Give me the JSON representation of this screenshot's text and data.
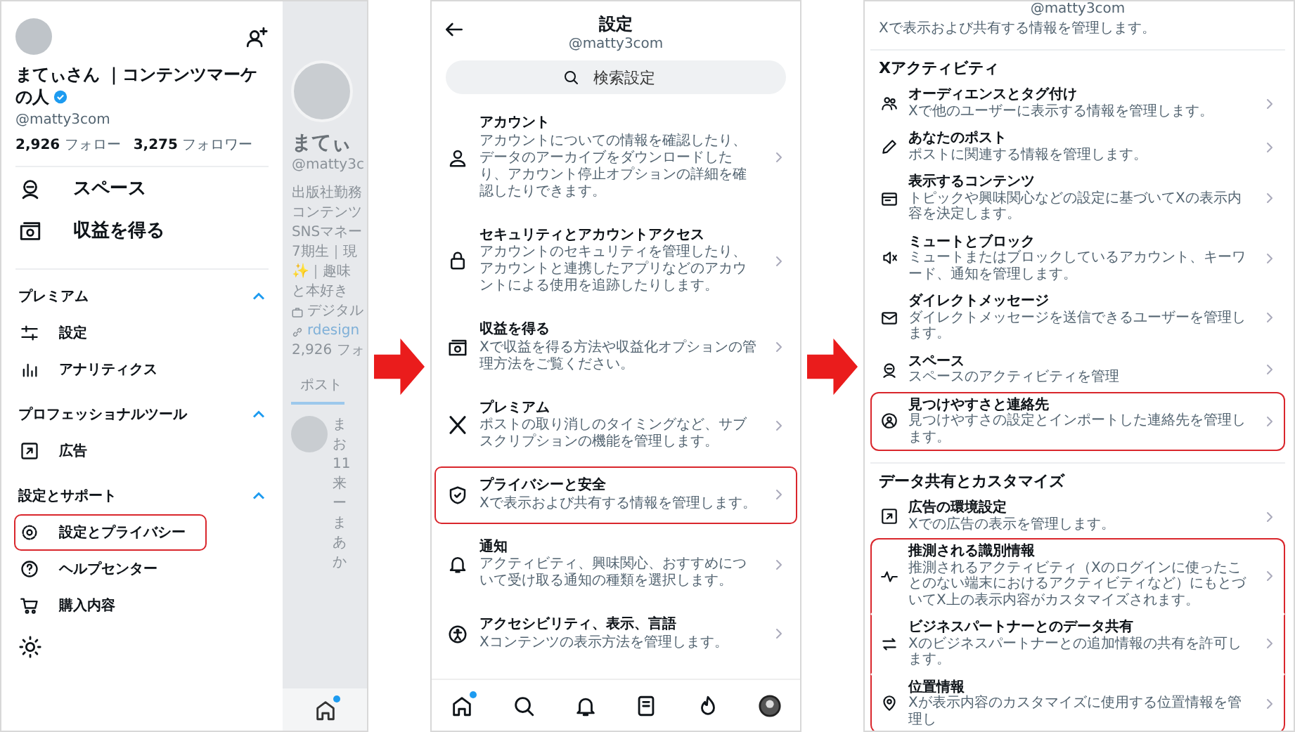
{
  "drawer": {
    "name": "まてぃさん ｜コンテンツマーケの人",
    "verified": true,
    "handle": "@matty3com",
    "stats": [
      "**2,926** フォロー",
      "**3,275** フォロワー"
    ],
    "main_items": [
      "スペース",
      "収益を得る"
    ],
    "sections": [
      {
        "title": "プレミアム",
        "expanded": true,
        "items": [
          {
            "label": "設定",
            "highlighted": false
          },
          {
            "label": "アナリティクス",
            "highlighted": false
          }
        ]
      },
      {
        "title": "プロフェッショナルツール",
        "expanded": true,
        "items": [
          {
            "label": "広告",
            "highlighted": false
          }
        ]
      },
      {
        "title": "設定とサポート",
        "expanded": true,
        "items": [
          {
            "label": "設定とプライバシー",
            "highlighted": true
          },
          {
            "label": "ヘルプセンター",
            "highlighted": false
          },
          {
            "label": "購入内容",
            "highlighted": false
          }
        ]
      }
    ]
  },
  "profile_behind": {
    "name": "まてぃ",
    "handle": "@matty3c",
    "bio": [
      "出版社勤務",
      "コンテンツ",
      "SNSマネー",
      "7期生｜現",
      "✨｜趣味",
      "と本好き"
    ],
    "work": "デジタル",
    "link": "rdesign",
    "following": "2,926 フォ",
    "tab": "ポスト",
    "post_head": [
      "ま",
      "お"
    ],
    "post_body": [
      "11",
      "来",
      "ー",
      "ま",
      "あ",
      "か"
    ],
    "home_dot": true
  },
  "settings": {
    "title": "設定",
    "handle": "@matty3com",
    "search": {
      "placeholder": "検索設定"
    },
    "items": [
      {
        "title": "アカウント",
        "description": "アカウントについての情報を確認したり、データのアーカイブをダウンロードしたり、アカウント停止オプションの詳細を確認したりできます。",
        "highlighted": false
      },
      {
        "title": "セキュリティとアカウントアクセス",
        "description": "アカウントのセキュリティを管理したり、アカウントと連携したアプリなどのアカウントによる使用を追跡したりします。",
        "highlighted": false
      },
      {
        "title": "収益を得る",
        "description": "Xで収益を得る方法や収益化オプションの管理方法をご覧ください。",
        "highlighted": false
      },
      {
        "title": "プレミアム",
        "description": "ポストの取り消しのタイミングなど、サブスクリプションの機能を管理します。",
        "highlighted": false
      },
      {
        "title": "プライバシーと安全",
        "description": "Xで表示および共有する情報を管理します。",
        "highlighted": true
      },
      {
        "title": "通知",
        "description": "アクティビティ、興味関心、おすすめについて受け取る通知の種類を選択します。",
        "highlighted": false
      },
      {
        "title": "アクセシビリティ、表示、言語",
        "description": "Xコンテンツの表示方法を管理します。",
        "highlighted": false
      }
    ],
    "bottom_nav": [
      {
        "dot": true
      },
      {
        "dot": false
      },
      {
        "dot": false
      },
      {
        "dot": false
      },
      {
        "dot": false
      },
      {
        "dot": false
      }
    ]
  },
  "privacy": {
    "handle": "@matty3com",
    "description": "Xで表示および共有する情報を管理します。",
    "sections": [
      {
        "title": "Xアクティビティ",
        "items": [
          {
            "title": "オーディエンスとタグ付け",
            "description": "Xで他のユーザーに表示する情報を管理します。",
            "highlighted": false
          },
          {
            "title": "あなたのポスト",
            "description": "ポストに関連する情報を管理します。",
            "highlighted": false
          },
          {
            "title": "表示するコンテンツ",
            "description": "トピックや興味関心などの設定に基づいてXの表示内容を決定します。",
            "highlighted": false
          },
          {
            "title": "ミュートとブロック",
            "description": "ミュートまたはブロックしているアカウント、キーワード、通知を管理します。",
            "highlighted": false
          },
          {
            "title": "ダイレクトメッセージ",
            "description": "ダイレクトメッセージを送信できるユーザーを管理します。",
            "highlighted": false
          },
          {
            "title": "スペース",
            "description": "スペースのアクティビティを管理",
            "highlighted": false
          },
          {
            "title": "見つけやすさと連絡先",
            "description": "見つけやすさの設定とインポートした連絡先を管理します。",
            "highlighted": true
          }
        ]
      },
      {
        "title": "データ共有とカスタマイズ",
        "items": [
          {
            "title": "広告の環境設定",
            "description": "Xでの広告の表示を管理します。",
            "highlighted": false
          },
          {
            "title": "推測される識別情報",
            "description": "推測されるアクティビティ（Xのログインに使ったことのない端末におけるアクティビティなど）にもとづいてX上の表示内容がカスタマイズされます。",
            "highlighted": true
          },
          {
            "title": "ビジネスパートナーとのデータ共有",
            "description": "Xのビジネスパートナーとの追加情報の共有を許可します。",
            "highlighted": true
          },
          {
            "title": "位置情報",
            "description": "Xが表示内容のカスタマイズに使用する位置情報を管理し",
            "highlighted": true
          }
        ]
      }
    ]
  }
}
